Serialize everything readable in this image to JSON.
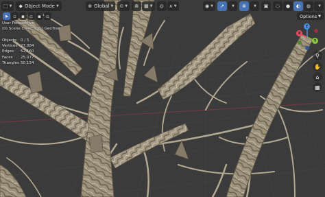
{
  "header": {
    "mode_label": "Object Mode",
    "orientation_label": "Global",
    "options_label": "Options"
  },
  "viewport": {
    "view_name": "User Perspective",
    "collection_line": "(0) Scene Collection | GeoTree"
  },
  "stats": [
    {
      "label": "Objects",
      "value": "0 / 5"
    },
    {
      "label": "Vertices",
      "value": "27,084"
    },
    {
      "label": "Edges",
      "value": "52,160"
    },
    {
      "label": "Faces",
      "value": "25,077"
    },
    {
      "label": "Triangles",
      "value": "50,154"
    }
  ],
  "gizmo": {
    "x_label": "X",
    "y_label": "Y",
    "z_label": "Z",
    "x_color": "#e84a5f",
    "y_color": "#8cc63f",
    "z_color": "#4b8fe2"
  },
  "colors": {
    "accent": "#4772b3",
    "background": "#3b3b3b",
    "bark_light": "#a89d87",
    "bark_dark": "#6e6553"
  }
}
